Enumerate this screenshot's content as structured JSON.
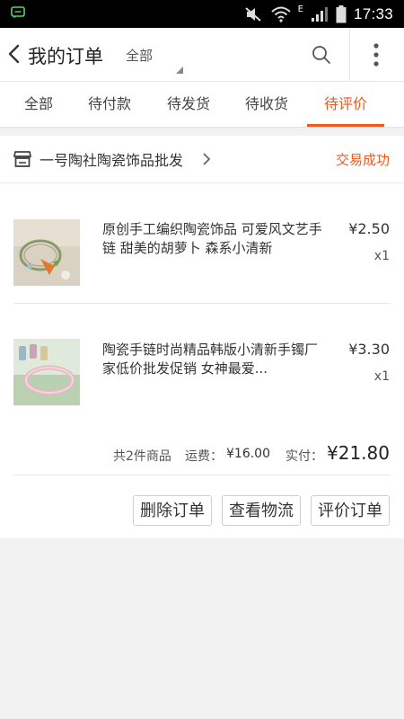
{
  "status_bar": {
    "time": "17:33",
    "network_label": "E"
  },
  "header": {
    "title": "我的订单",
    "filter_value": "全部"
  },
  "tabs": [
    {
      "label": "全部"
    },
    {
      "label": "待付款"
    },
    {
      "label": "待发货"
    },
    {
      "label": "待收货"
    },
    {
      "label": "待评价"
    }
  ],
  "active_tab": "待评价",
  "order": {
    "shop_name": "一号陶社陶瓷饰品批发",
    "status": "交易成功",
    "items": [
      {
        "title": "原创手工编织陶瓷饰品 可爱风文艺手链 甜美的胡萝卜 森系小清新",
        "price": "¥2.50",
        "qty": "x1"
      },
      {
        "title": "陶瓷手链时尚精品韩版小清新手镯厂家低价批发促销 女神最爱...",
        "price": "¥3.30",
        "qty": "x1"
      }
    ],
    "summary": {
      "count_text": "共2件商品",
      "shipping_label": "运费：",
      "shipping_value": "¥16.00",
      "paid_label": "实付：",
      "paid_value": "¥21.80"
    },
    "actions": [
      {
        "label": "删除订单"
      },
      {
        "label": "查看物流"
      },
      {
        "label": "评价订单"
      }
    ]
  },
  "colors": {
    "accent": "#f2581a",
    "background": "#f2f2f2"
  }
}
